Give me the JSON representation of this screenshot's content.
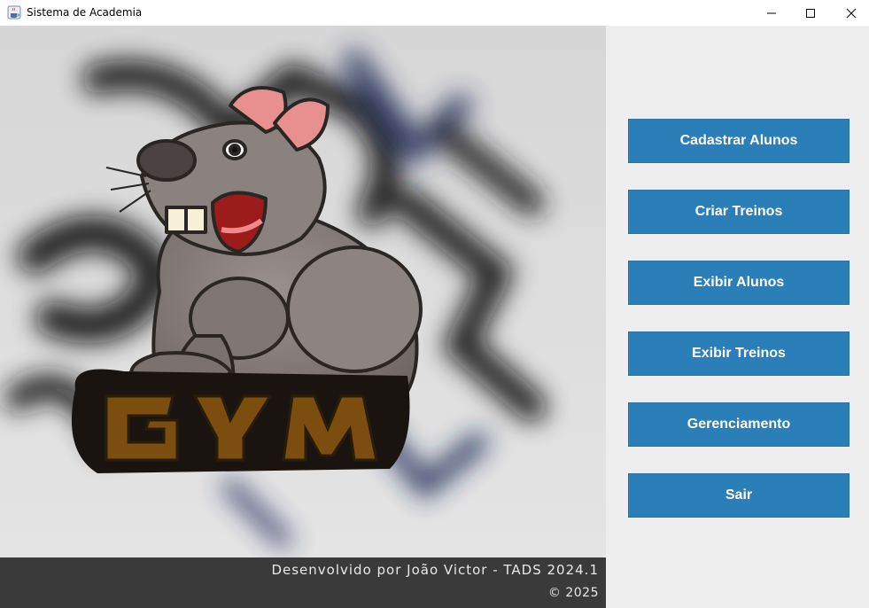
{
  "window": {
    "title": "Sistema de Academia",
    "icon": "java-coffee-icon",
    "controls": [
      "minimize-icon",
      "maximize-icon",
      "close-icon"
    ]
  },
  "image_panel": {
    "logo_text": "GYM",
    "footer": {
      "credit": "Desenvolvido por João Victor - TADS 2024.1",
      "copyright": "© 2025"
    }
  },
  "menu": {
    "buttons": [
      {
        "label": "Cadastrar Alunos"
      },
      {
        "label": "Criar Treinos"
      },
      {
        "label": "Exibir Alunos"
      },
      {
        "label": "Exibir Treinos"
      },
      {
        "label": "Gerenciamento"
      },
      {
        "label": "Sair"
      }
    ]
  },
  "colors": {
    "button_bg": "#2b7fb9",
    "button_text": "#ffffff",
    "footer_bg": "#3a3a3a"
  }
}
